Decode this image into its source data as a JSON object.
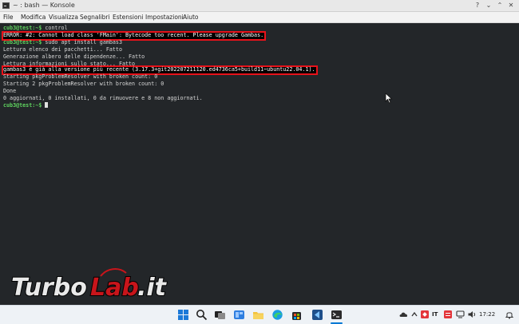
{
  "window": {
    "title": "~ : bash — Konsole",
    "help_glyph": "?",
    "minimize_glyph": "⌄",
    "maximize_glyph": "⌃",
    "close_glyph": "✕"
  },
  "menubar": {
    "items": [
      "File",
      "Modifica",
      "Visualizza",
      "Segnalibri",
      "Estensioni",
      "Impostazioni",
      "Aiuto"
    ]
  },
  "terminal": {
    "prompt": "cub3@test:~$",
    "lines": {
      "l0_cmd": " control",
      "l1": "ERROR: #2: Cannot load class 'FMain': Bytecode too recent. Please upgrade Gambas.",
      "l2_cmd": " sudo apt install gambas3",
      "l3": "Lettura elenco dei pacchetti... Fatto",
      "l4": "Generazione albero delle dipendenze... Fatto",
      "l5": "Lettura informazioni sullo stato... Fatto",
      "l6": "gambas3 è già alla versione più recente (3.17.3+git202207211120.ed4736ca5+build11~ubuntu22.04.1).",
      "l7": "Starting pkgProblemResolver with broken count: 0",
      "l8": "Starting 2 pkgProblemResolver with broken count: 0",
      "l9": "Done",
      "l10": "0 aggiornati, 0 installati, 0 da rimuovere e 8 non aggiornati."
    }
  },
  "watermark": {
    "text": "TurboLab.it"
  },
  "taskbar": {
    "icons": [
      "windows-start-icon",
      "search-icon",
      "task-view-icon",
      "widgets-icon",
      "file-explorer-icon",
      "edge-browser-icon",
      "store-icon",
      "vscode-icon",
      "terminal-icon"
    ],
    "tray": {
      "language": "IT",
      "time": "17:22"
    }
  },
  "colors": {
    "terminal_bg": "#232629",
    "prompt_green": "#5fd35f",
    "highlight_red": "#e8121a",
    "watermark_red": "#c8151b"
  }
}
